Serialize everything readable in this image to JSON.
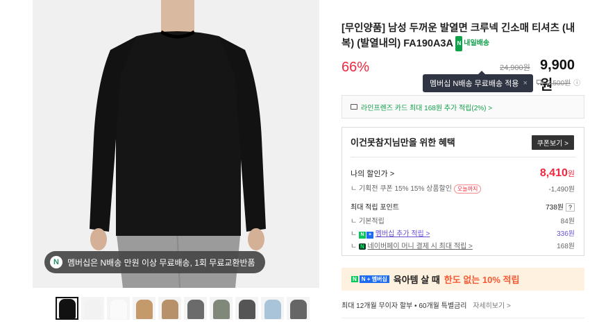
{
  "product": {
    "title": "[무인양품] 남성 두꺼운 발열면 크루넥 긴소매 티셔츠 (내복) (발열내의) FA190A3A",
    "delivery_tag_badge": "N",
    "delivery_tag": "내일배송"
  },
  "gallery": {
    "promo_badge": "N",
    "promo_text": "멤버십은 N배송 만원 이상 무료배송, 1회 무료교환반품",
    "thumb_colors": [
      "#111111",
      "#f2f2f2",
      "#fafafa",
      "#c49a6c",
      "#b7916a",
      "#6b6b6b",
      "#80887a",
      "#555555",
      "#a9c4d8",
      "#666666"
    ]
  },
  "price": {
    "discount": "66%",
    "original": "24,900원",
    "final": "9,900원",
    "tooltip": "멤버십 N배송 무료배송 적용",
    "tooltip_close": "×",
    "shipping_icon": "truck-icon",
    "shipping_fee": "3,500원",
    "info_icon": "ⓘ"
  },
  "card_banner": {
    "text": "라인프렌즈 카드 최대 168원 추가 적립(2%) >"
  },
  "benefit": {
    "heading": "이건못참지님만을 위한 혜택",
    "coupon_button": "쿠폰보기 >",
    "my_price_label": "나의 할인가 >",
    "my_price_value": "8,410",
    "my_price_unit": "원",
    "coupon_line": "ㄴ 기획전 쿠폰 15% 15% 상품할인",
    "today_badge": "오늘까지",
    "coupon_amount": "-1,490원",
    "points_label": "최대 적립 포인트",
    "points_value": "738원",
    "points_help": "?",
    "basic_label": "ㄴ 기본적립",
    "basic_value": "84원",
    "membership_label": "멤버십 추가 적립 >",
    "membership_value": "336원",
    "npay_label": "네이버페이 머니 결제 시 최대 적립 >",
    "npay_value": "168원"
  },
  "baby_banner": {
    "badge": "N + 멤버십",
    "text_bold": "육아템 살 때",
    "text_highlight": "한도 없는 10% 적립"
  },
  "installment": {
    "text": "최대 12개월 무이자 할부 • 60개월 특별금리",
    "more": "자세히보기 >"
  },
  "colors": {
    "accent_red": "#f0273f",
    "naver_green": "#11a14a",
    "tooltip_bg": "#2f3542",
    "membership_purple": "#6a4fd6"
  }
}
